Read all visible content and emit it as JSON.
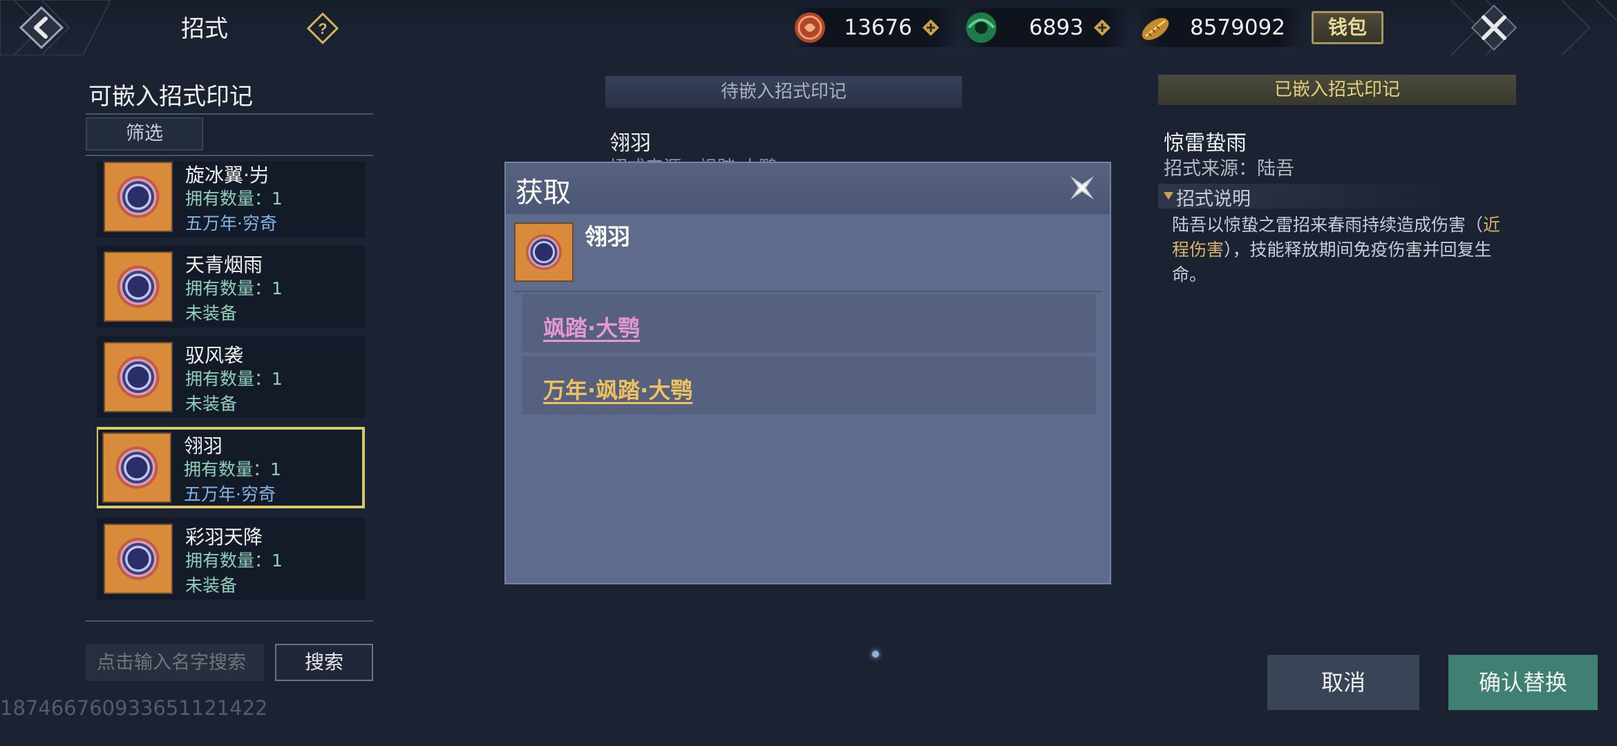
{
  "header": {
    "title": "招式",
    "wallet_label": "钱包",
    "currencies": [
      {
        "icon": "red-coin-icon",
        "value": "13676"
      },
      {
        "icon": "jade-coin-icon",
        "value": "6893"
      },
      {
        "icon": "gold-ingot-icon",
        "value": "8579092"
      }
    ]
  },
  "left": {
    "title": "可嵌入招式印记",
    "filter_label": "筛选",
    "items": [
      {
        "name": "旋冰翼·屴",
        "count": "拥有数量：1",
        "state": "五万年·穷奇",
        "state_style": "blue"
      },
      {
        "name": "天青烟雨",
        "count": "拥有数量：1",
        "state": "未装备",
        "state_style": "green"
      },
      {
        "name": "驭风袭",
        "count": "拥有数量：1",
        "state": "未装备",
        "state_style": "green"
      },
      {
        "name": "翎羽",
        "count": "拥有数量：1",
        "state": "五万年·穷奇",
        "state_style": "blue"
      },
      {
        "name": "彩羽天降",
        "count": "拥有数量：1",
        "state": "未装备",
        "state_style": "green"
      }
    ],
    "search_placeholder": "点击输入名字搜索",
    "search_label": "搜索",
    "uid": "18746676093365112142​2"
  },
  "middle": {
    "header": "待嵌入招式印记",
    "name": "翎羽",
    "source": "招式来源：飒踏·大鹗"
  },
  "right": {
    "header": "已嵌入招式印记",
    "name": "惊雷蛰雨",
    "source": "招式来源：陆吾",
    "section_title": "招式说明",
    "desc_a": "陆吾以惊蛰之雷招来春雨持续造成伤害（",
    "desc_hl": "近程伤害",
    "desc_b": "），技能释放期间免疫伤害并回复生命。"
  },
  "buttons": {
    "cancel": "取消",
    "confirm": "确认替换"
  },
  "modal": {
    "title": "获取",
    "item_name": "翎羽",
    "sources": [
      {
        "label": "飒踏·大鹗",
        "color": "#e597d4"
      },
      {
        "label": "万年·飒踏·大鹗",
        "color": "#f0c05e"
      }
    ]
  }
}
